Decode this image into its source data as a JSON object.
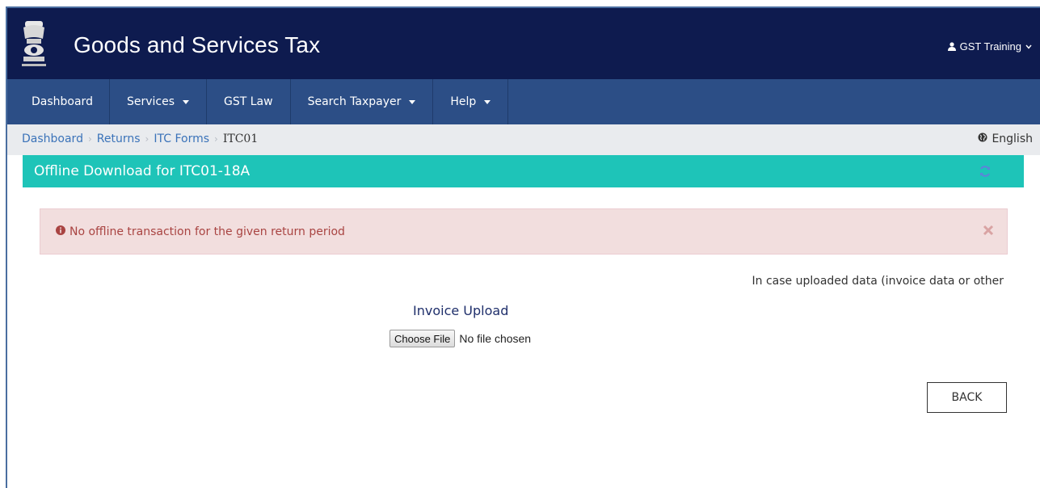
{
  "header": {
    "title": "Goods and Services Tax",
    "user": "GST Training",
    "emblem_icon": "national-emblem",
    "background": "#0e1b4f"
  },
  "nav": {
    "items": [
      {
        "label": "Dashboard",
        "dropdown": false
      },
      {
        "label": "Services",
        "dropdown": true
      },
      {
        "label": "GST Law",
        "dropdown": false
      },
      {
        "label": "Search Taxpayer",
        "dropdown": true
      },
      {
        "label": "Help",
        "dropdown": true
      }
    ],
    "background": "#2c4e86"
  },
  "breadcrumb": {
    "items": [
      "Dashboard",
      "Returns",
      "ITC Forms"
    ],
    "current": "ITC01",
    "language": "English"
  },
  "panel": {
    "title": "Offline Download for ITC01-18A",
    "accent": "#1ec4b8"
  },
  "alert": {
    "message": "No offline transaction for the given return period",
    "color": "#a94442",
    "background": "#f2dede"
  },
  "note": "In case uploaded data (invoice data or other",
  "upload": {
    "label": "Invoice Upload",
    "button": "Choose File",
    "status": "No file chosen"
  },
  "back_button": "BACK"
}
